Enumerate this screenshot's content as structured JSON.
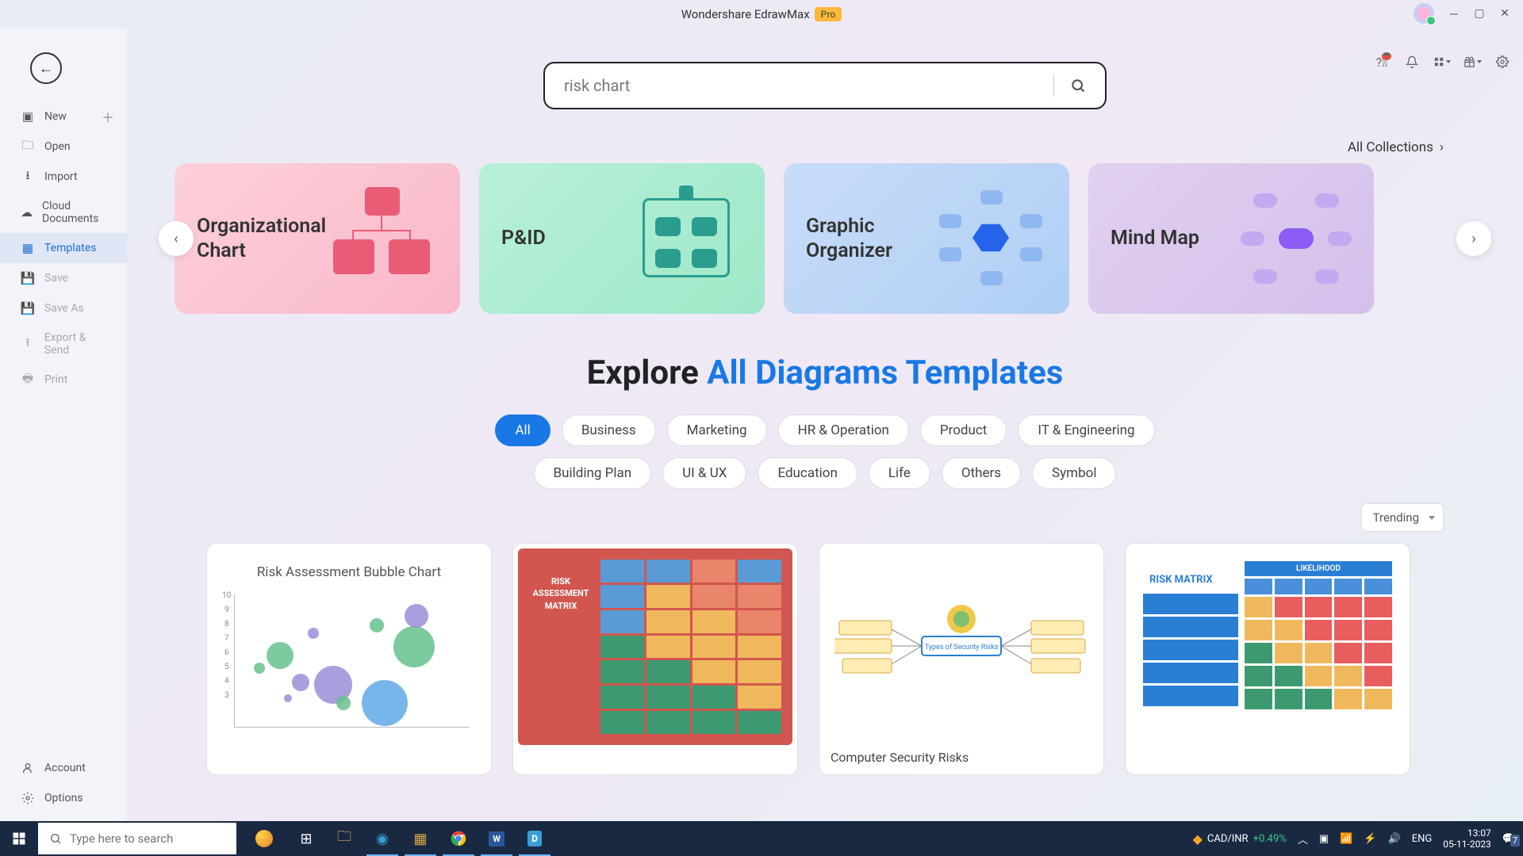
{
  "titlebar": {
    "title": "Wondershare EdrawMax",
    "pro": "Pro"
  },
  "sidebar": {
    "items": [
      {
        "label": "New",
        "icon": "plus-square-icon",
        "hasPlus": true
      },
      {
        "label": "Open",
        "icon": "folder-icon"
      },
      {
        "label": "Import",
        "icon": "import-icon"
      },
      {
        "label": "Cloud Documents",
        "icon": "cloud-icon"
      },
      {
        "label": "Templates",
        "icon": "templates-icon"
      },
      {
        "label": "Save",
        "icon": "save-icon"
      },
      {
        "label": "Save As",
        "icon": "save-as-icon"
      },
      {
        "label": "Export & Send",
        "icon": "export-icon"
      },
      {
        "label": "Print",
        "icon": "print-icon"
      }
    ],
    "account": "Account",
    "options": "Options"
  },
  "search": {
    "value": "risk chart"
  },
  "allCollections": "All Collections",
  "carousel": {
    "items": [
      {
        "title": "Organizational Chart"
      },
      {
        "title": "P&ID"
      },
      {
        "title": "Graphic Organizer"
      },
      {
        "title": "Mind Map"
      }
    ]
  },
  "explore": {
    "prefix": "Explore ",
    "highlight": "All Diagrams Templates"
  },
  "filters": [
    "All",
    "Business",
    "Marketing",
    "HR & Operation",
    "Product",
    "IT & Engineering",
    "Building Plan",
    "UI & UX",
    "Education",
    "Life",
    "Others",
    "Symbol"
  ],
  "sort": {
    "value": "Trending"
  },
  "templates": [
    {
      "title": "Risk Assessment Bubble Chart"
    },
    {
      "title": ""
    },
    {
      "title": "Computer Security Risks"
    },
    {
      "title": ""
    }
  ],
  "taskbar": {
    "searchPlaceholder": "Type here to search",
    "stock": {
      "pair": "CAD/INR",
      "change": "+0.49%"
    },
    "lang": "ENG",
    "time": "13:07",
    "date": "05-11-2023",
    "notif": "7"
  },
  "thumb1": {
    "title": "Risk Assessment Bubble Chart"
  },
  "thumb2": {
    "t1": "RISK",
    "t2": "ASSESSMENT",
    "t3": "MATRIX"
  },
  "thumb3": {
    "center": "Types of Security Risks"
  },
  "thumb4": {
    "title": "RISK MATRIX",
    "head": "LIKELIHOOD"
  }
}
